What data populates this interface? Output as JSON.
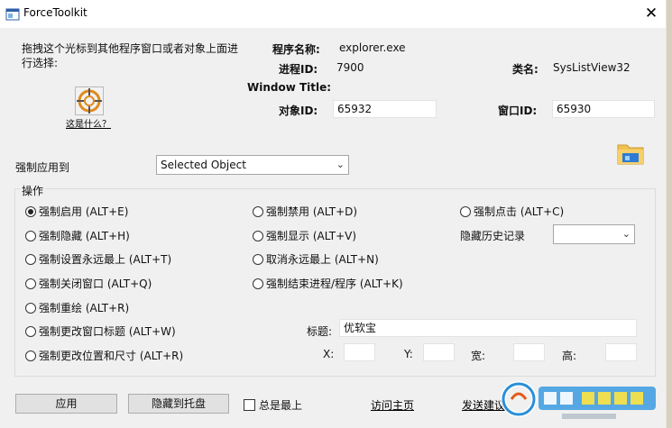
{
  "window": {
    "title": "ForceToolkit",
    "close_glyph": "✕"
  },
  "info": {
    "instruction": "拖拽这个光标到其他程序窗口或者对象上面进行选择:",
    "whatis_link": "这是什么？",
    "program_name_label": "程序名称:",
    "program_name_value": "explorer.exe",
    "process_id_label": "进程ID:",
    "process_id_value": "7900",
    "class_name_label": "类名:",
    "class_name_value": "SysListView32",
    "window_title_label": "Window Title:",
    "object_id_label": "对象ID:",
    "object_id_value": "65932",
    "window_id_label": "窗口ID:",
    "window_id_value": "65930"
  },
  "apply_to": {
    "label": "强制应用到",
    "selected": "Selected Object"
  },
  "operations": {
    "group_title": "操作",
    "options": [
      {
        "label": "强制启用 (ALT+E)",
        "checked": true
      },
      {
        "label": "强制禁用 (ALT+D)",
        "checked": false
      },
      {
        "label": "强制点击 (ALT+C)",
        "checked": false
      },
      {
        "label": "强制隐藏 (ALT+H)",
        "checked": false
      },
      {
        "label": "强制显示 (ALT+V)",
        "checked": false
      },
      {
        "label": "强制设置永远最上 (ALT+T)",
        "checked": false
      },
      {
        "label": "取消永远最上 (ALT+N)",
        "checked": false
      },
      {
        "label": "强制关闭窗口 (ALT+Q)",
        "checked": false
      },
      {
        "label": "强制结束进程/程序 (ALT+K)",
        "checked": false
      },
      {
        "label": "强制重绘 (ALT+R)",
        "checked": false
      },
      {
        "label": "强制更改窗口标题 (ALT+W)",
        "checked": false
      },
      {
        "label": "强制更改位置和尺寸 (ALT+R)",
        "checked": false
      }
    ],
    "history_label": "隐藏历史记录",
    "history_selected": "",
    "title_label": "标题:",
    "title_value": "优软宝",
    "x_label": "X:",
    "y_label": "Y:",
    "w_label": "宽:",
    "h_label": "高:"
  },
  "footer": {
    "apply_button": "应用",
    "tray_button": "隐藏到托盘",
    "always_top_label": "总是最上",
    "home_link": "访问主页",
    "send_link": "发送建议"
  },
  "colors": {
    "dialog_bg": "#f0f0f0",
    "title_bg": "#ffffff",
    "crosshair_orange": "#e08a1e"
  },
  "icons": {
    "app": "app-window-icon",
    "crosshair": "crosshair-target-icon",
    "folder": "folder-icon",
    "dropdown": "chevron-down-icon"
  }
}
